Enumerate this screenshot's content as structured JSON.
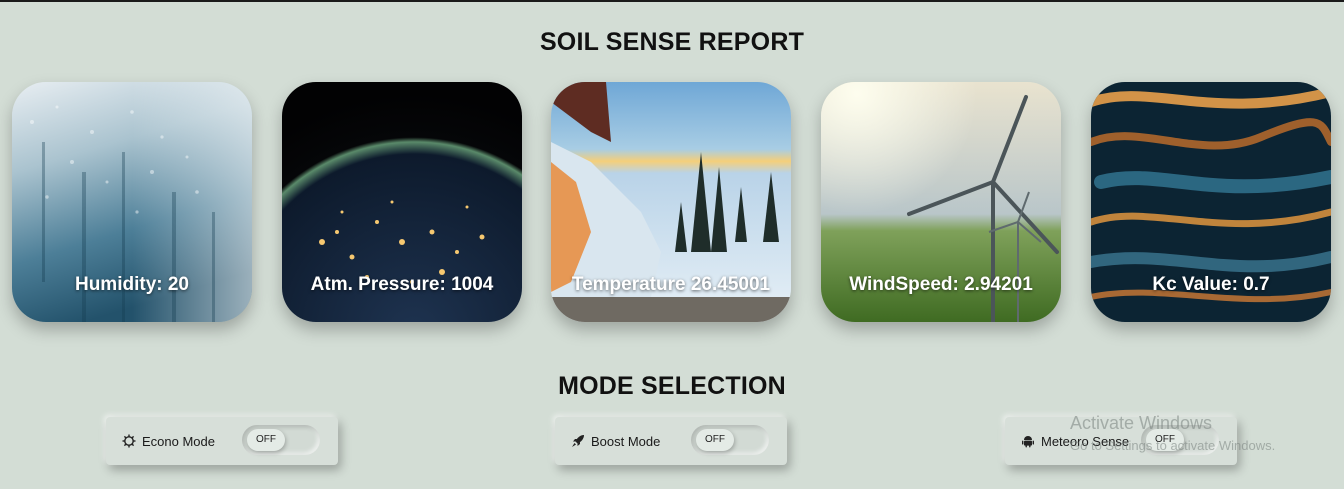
{
  "header": {
    "title": "SOIL SENSE REPORT"
  },
  "cards": [
    {
      "id": "humidity",
      "label": "Humidity: 20",
      "image": "condensation-water-droplets-photo"
    },
    {
      "id": "pressure",
      "label": "Atm. Pressure: 1004",
      "image": "earth-at-night-from-space-photo"
    },
    {
      "id": "temperature",
      "label": "Temperature 26.45001",
      "image": "frosty-window-winter-sunset-photo"
    },
    {
      "id": "wind",
      "label": "WindSpeed: 2.94201",
      "image": "wind-turbines-green-field-photo"
    },
    {
      "id": "kc",
      "label": "Kc Value: 0.7",
      "image": "rippling-dark-water-orange-reflections-photo"
    }
  ],
  "modes": {
    "title": "MODE SELECTION",
    "items": [
      {
        "id": "econo",
        "label": "Econo Mode",
        "icon": "gear-icon",
        "state": "OFF"
      },
      {
        "id": "boost",
        "label": "Boost Mode",
        "icon": "rocket-icon",
        "state": "OFF"
      },
      {
        "id": "meteoro",
        "label": "Meteoro Sense",
        "icon": "android-icon",
        "state": "OFF"
      }
    ]
  },
  "watermark": {
    "title": "Activate Windows",
    "subtitle": "Go to Settings to activate Windows."
  },
  "colors": {
    "background": "#d3ddd5",
    "card_text": "#ffffff",
    "title_text": "#111111"
  }
}
